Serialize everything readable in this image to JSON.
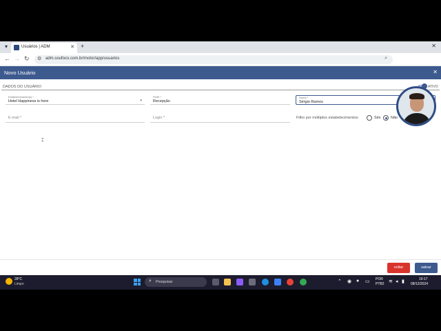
{
  "browser": {
    "tab_title": "Usuários | ADM",
    "url": "adm.soufoco.com.br/motor/app/usuarios"
  },
  "app": {
    "header_title": "Novo Usuário",
    "section_title": "DADOS DO USUÁRIO",
    "status_toggle_label": "ATIVO",
    "status_active": true
  },
  "form": {
    "establishment": {
      "label": "Estabelecimento(s) *",
      "value": "Hotel Happiness is here"
    },
    "profile": {
      "label": "Perfil *",
      "value": "Recepção"
    },
    "name": {
      "label": "Nome *",
      "value": "Sérgio Ramos"
    },
    "email": {
      "placeholder": "E-mail *"
    },
    "login": {
      "placeholder": "Login *"
    },
    "multi_filter": {
      "label": "Filtro por múltiplos estabelecimentos:",
      "options": [
        "Sim",
        "Não"
      ],
      "selected": "Não"
    }
  },
  "footer": {
    "back_label": "voltar",
    "save_label": "salvar"
  },
  "taskbar": {
    "weather_temp": "28°C",
    "weather_desc": "Limpo",
    "search_label": "Pesquisar",
    "lang_line1": "POR",
    "lang_line2": "PTB2",
    "time": "19:17",
    "date": "08/12/2024"
  },
  "colors": {
    "header": "#3d5a8f",
    "save_button": "#3d5a8f",
    "back_button": "#d9342b"
  }
}
